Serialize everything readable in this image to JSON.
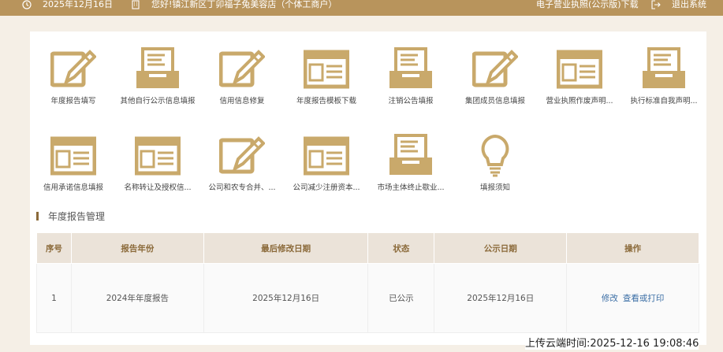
{
  "header": {
    "date": "2025年12月16日",
    "greeting": "您好!镇江新区丁卯福子兔美容店（个体工商户）",
    "license_link": "电子营业执照(公示版)下载",
    "exit_label": "退出系统",
    "accent_color": "#b8945c"
  },
  "tiles": [
    {
      "label": "年度报告填写",
      "icon": "pencil-icon"
    },
    {
      "label": "其他自行公示信息填报",
      "icon": "inbox-icon"
    },
    {
      "label": "信用信息修复",
      "icon": "pencil-icon"
    },
    {
      "label": "年度报告模板下载",
      "icon": "window-list-icon"
    },
    {
      "label": "注销公告填报",
      "icon": "inbox-icon"
    },
    {
      "label": "集团成员信息填报",
      "icon": "pencil-icon"
    },
    {
      "label": "营业执照作废声明...",
      "icon": "window-list-icon"
    },
    {
      "label": "执行标准自我声明...",
      "icon": "inbox-icon"
    },
    {
      "label": "信用承诺信息填报",
      "icon": "window-list-icon"
    },
    {
      "label": "名称转让及授权信...",
      "icon": "window-list-icon"
    },
    {
      "label": "公司和农专合并、...",
      "icon": "pencil-icon"
    },
    {
      "label": "公司减少注册资本...",
      "icon": "window-list-icon"
    },
    {
      "label": "市场主体终止歇业...",
      "icon": "inbox-icon"
    },
    {
      "label": "填报须知",
      "icon": "lightbulb-icon"
    }
  ],
  "section": {
    "title": "年度报告管理"
  },
  "table": {
    "headers": [
      "序号",
      "报告年份",
      "最后修改日期",
      "状态",
      "公示日期",
      "操作"
    ],
    "rows": [
      {
        "index": "1",
        "year": "2024年年度报告",
        "modified": "2025年12月16日",
        "status": "已公示",
        "published": "2025年12月16日",
        "actions": [
          "修改",
          "查看或打印"
        ]
      }
    ]
  },
  "overlay": {
    "timestamp": "上传云端时间:2025-12-16 19:08:46"
  }
}
